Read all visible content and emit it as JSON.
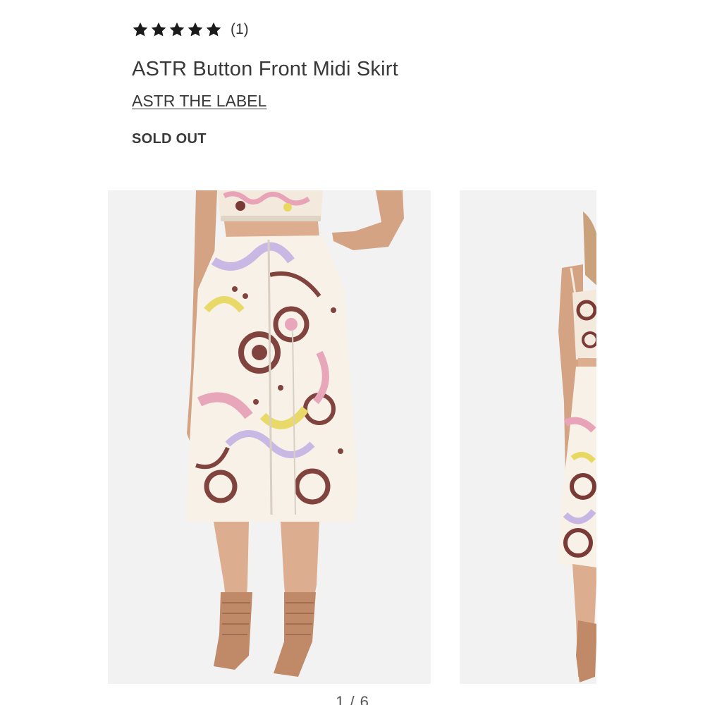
{
  "rating": {
    "stars_filled": 5,
    "stars_total": 5,
    "review_count": "(1)"
  },
  "product": {
    "title": "ASTR Button Front Midi Skirt",
    "brand": "ASTR THE LABEL",
    "availability": "SOLD OUT"
  },
  "gallery": {
    "pager_text": "1 / 6",
    "images": [
      {
        "name": "product-image-front"
      },
      {
        "name": "product-image-side"
      }
    ]
  },
  "colors": {
    "text": "#393939",
    "image_bg": "#f2f2f2",
    "skin": "#dcae8f",
    "fabric": "#f8f1e8",
    "print_maroon": "#7a3a35",
    "print_pink": "#e8a3b8",
    "print_yellow": "#e8d862",
    "print_lilac": "#c7b6e4",
    "shoe": "#c08a68"
  }
}
